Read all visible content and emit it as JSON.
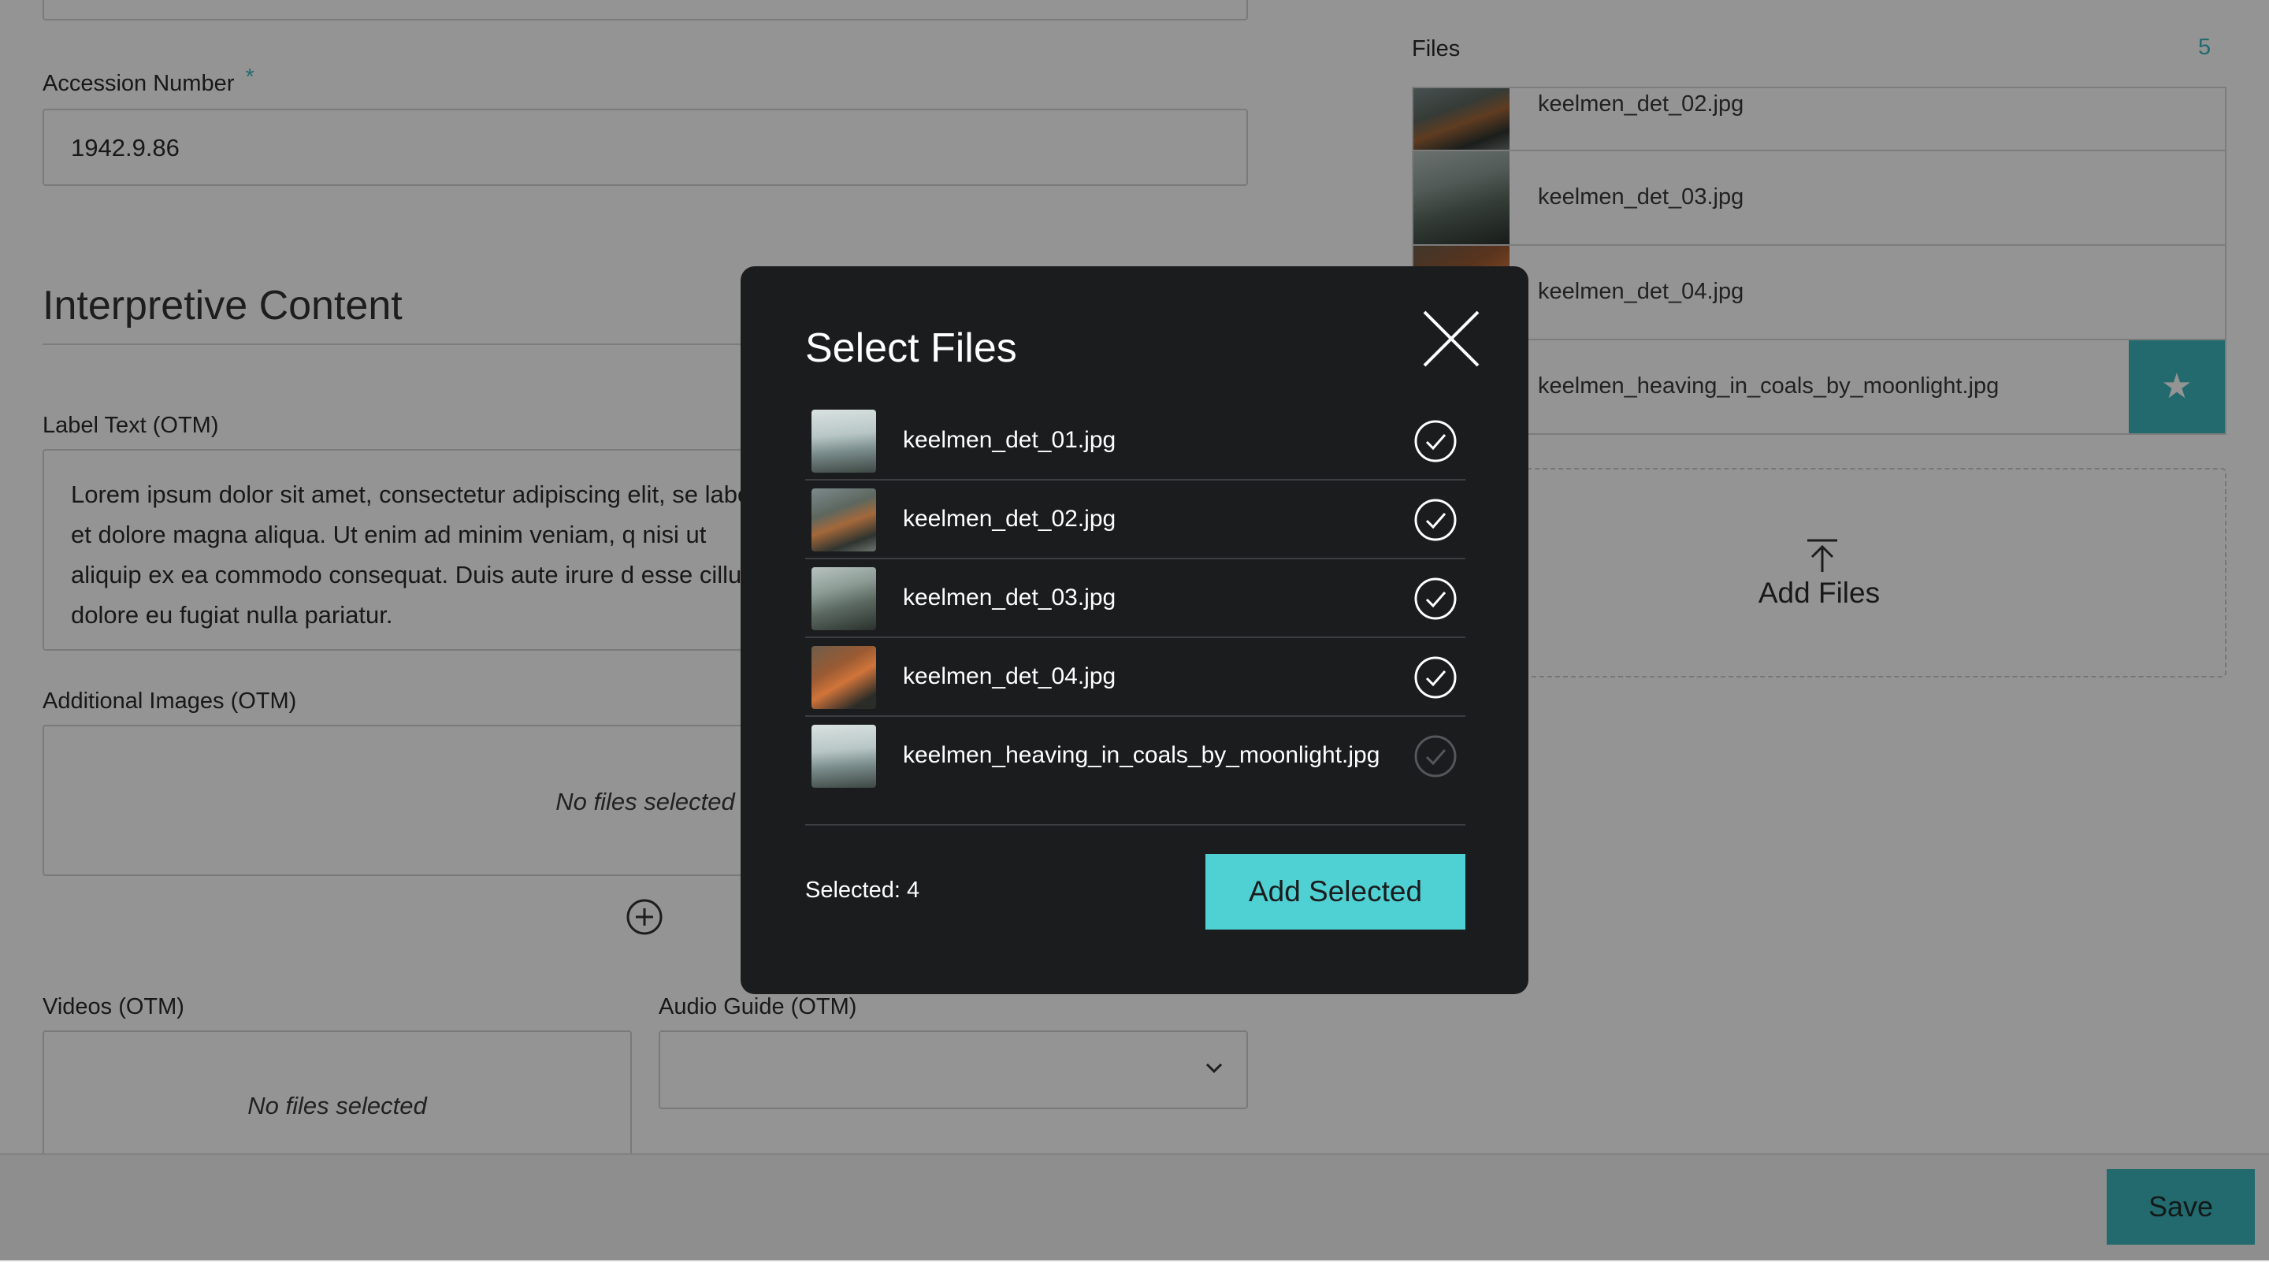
{
  "form": {
    "accession": {
      "label": "Accession Number",
      "required_mark": "*",
      "value": "1942.9.86"
    },
    "section_title": "Interpretive Content",
    "label_text": {
      "label": "Label Text (OTM)",
      "value": "Lorem ipsum dolor sit amet, consectetur adipiscing elit, se labore et dolore magna aliqua. Ut enim ad minim veniam, q nisi ut aliquip ex ea commodo consequat. Duis aute irure d esse cillum dolore eu fugiat nulla pariatur."
    },
    "additional_images": {
      "label": "Additional Images (OTM)",
      "empty_text": "No files selected"
    },
    "videos": {
      "label": "Videos (OTM)",
      "empty_text": "No files selected"
    },
    "audio_guide": {
      "label": "Audio Guide (OTM)",
      "value": ""
    }
  },
  "files_panel": {
    "title": "Files",
    "count": "5",
    "items": [
      {
        "name": "keelmen_det_02.jpg"
      },
      {
        "name": "keelmen_det_03.jpg"
      },
      {
        "name": "keelmen_det_04.jpg"
      },
      {
        "name": "keelmen_heaving_in_coals_by_moonlight.jpg",
        "starred": true
      }
    ],
    "add_files_label": "Add Files"
  },
  "modal": {
    "title": "Select Files",
    "files": [
      {
        "name": "keelmen_det_01.jpg",
        "selected": true
      },
      {
        "name": "keelmen_det_02.jpg",
        "selected": true
      },
      {
        "name": "keelmen_det_03.jpg",
        "selected": true
      },
      {
        "name": "keelmen_det_04.jpg",
        "selected": true
      },
      {
        "name": "keelmen_heaving_in_coals_by_moonlight.jpg",
        "selected": false
      }
    ],
    "selected_text": "Selected: 4",
    "add_button": "Add Selected"
  },
  "footer": {
    "save_label": "Save"
  },
  "colors": {
    "accent": "#3cb7bd",
    "accent_bright": "#4fd0d3",
    "modal_bg": "#1b1c1e"
  }
}
